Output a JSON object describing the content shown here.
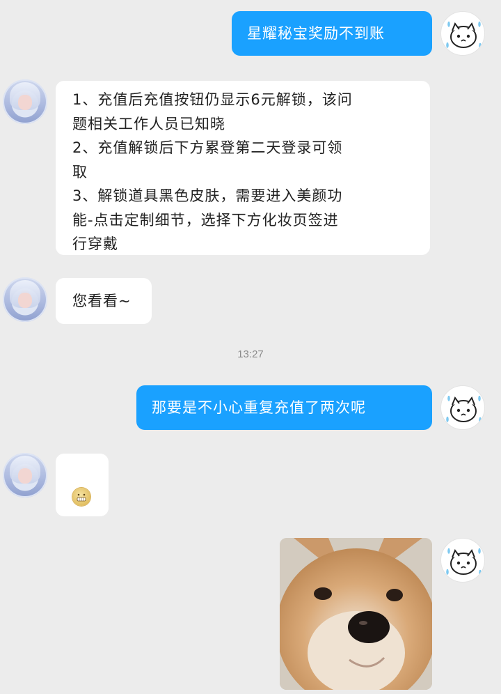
{
  "messages": [
    {
      "id": "m1",
      "side": "out",
      "text": "星耀秘宝奖励不到账"
    },
    {
      "id": "m2",
      "side": "in",
      "lines": [
        "1、充值后充值按钮仍显示6元解锁，该问",
        "题相关工作人员已知晓",
        "2、充值解锁后下方累登第二天登录可领",
        "取",
        "3、解锁道具黑色皮肤，需要进入美颜功",
        "能-点击定制细节，选择下方化妆页签进",
        "行穿戴"
      ]
    },
    {
      "id": "m3",
      "side": "in",
      "text": "您看看~"
    },
    {
      "id": "m4",
      "side": "out",
      "text": "那要是不小心重复充值了两次呢"
    },
    {
      "id": "m5",
      "side": "in",
      "type": "emoji"
    },
    {
      "id": "m6",
      "side": "out",
      "type": "photo"
    }
  ],
  "timestamp": "13:27",
  "colors": {
    "background": "#ececec",
    "outgoing_bubble": "#1aa1ff",
    "incoming_bubble": "#ffffff"
  },
  "icons": {
    "cs_avatar": "anime-girl-avatar-icon",
    "user_avatar": "crying-cartoon-avatar-icon",
    "emoji": "grimace-emoji-icon",
    "photo": "shiba-dog-photo"
  }
}
